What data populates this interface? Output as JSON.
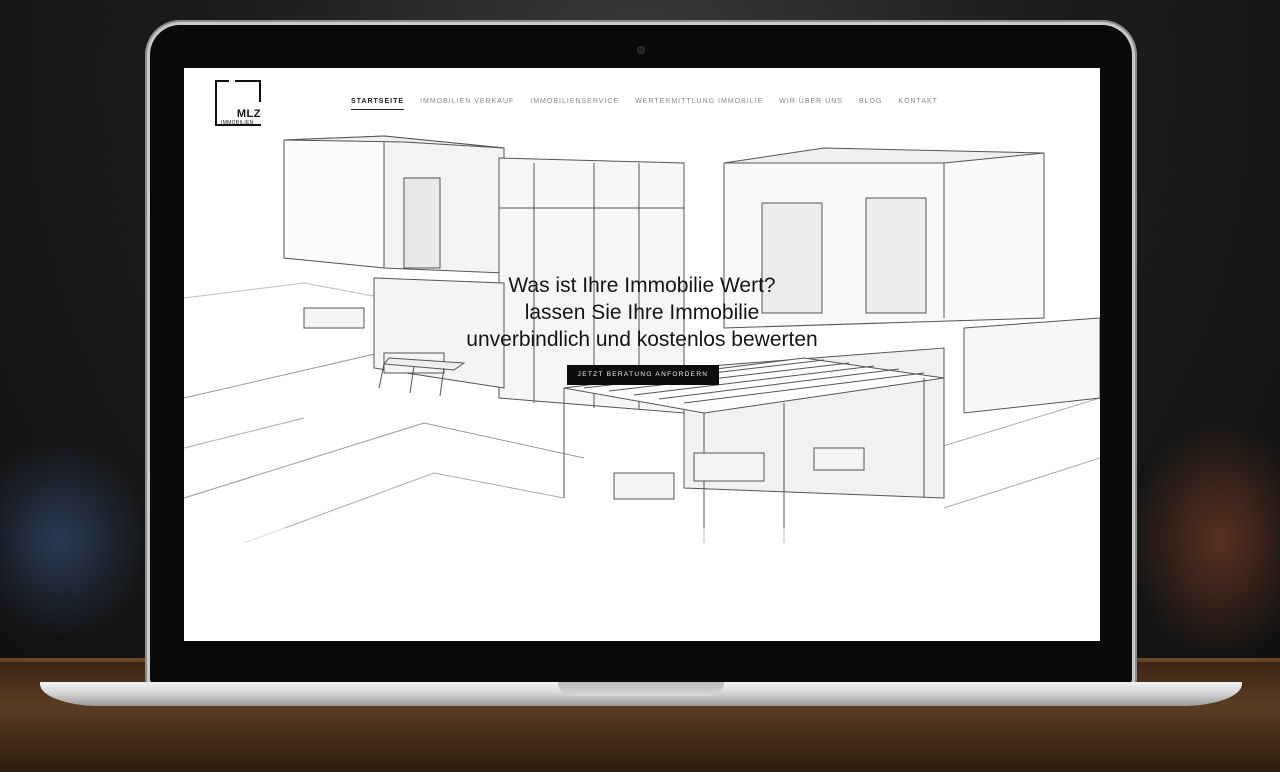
{
  "site": {
    "logo": {
      "name": "MLZ",
      "subtitle": "IMMOBILIEN"
    },
    "nav": [
      {
        "label": "STARTSEITE",
        "active": true
      },
      {
        "label": "IMMOBILIEN VERKAUF",
        "active": false
      },
      {
        "label": "IMMOBILIENSERVICE",
        "active": false
      },
      {
        "label": "WERTERMITTLUNG IMMOBILIE",
        "active": false
      },
      {
        "label": "WIR ÜBER UNS",
        "active": false
      },
      {
        "label": "BLOG",
        "active": false
      },
      {
        "label": "KONTAKT",
        "active": false
      }
    ],
    "hero": {
      "headline_lines": [
        "Was ist Ihre Immobilie Wert?",
        "lassen Sie Ihre Immobilie",
        "unverbindlich und kostenlos bewerten"
      ],
      "cta_label": "JETZT BERATUNG ANFORDERN"
    }
  },
  "colors": {
    "accent": "#0d0d0d",
    "nav_inactive": "#888888",
    "nav_active": "#222222"
  }
}
